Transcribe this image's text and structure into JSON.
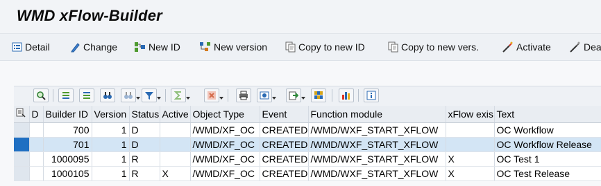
{
  "title": "WMD xFlow-Builder",
  "toolbar": [
    {
      "label": "Detail",
      "icon": "detail-icon"
    },
    {
      "label": "Change",
      "icon": "pencil-icon"
    },
    {
      "label": "New ID",
      "icon": "new-id-icon"
    },
    {
      "label": "New version",
      "icon": "new-version-icon"
    },
    {
      "label": "Copy to new ID",
      "icon": "copy-icon"
    },
    {
      "label": "Copy to new vers.",
      "icon": "copy-icon"
    },
    {
      "label": "Activate",
      "icon": "wand-icon"
    },
    {
      "label": "Dea",
      "icon": "wand-icon"
    }
  ],
  "grid": {
    "headers": [
      "",
      "D",
      "Builder ID",
      "Version",
      "Status",
      "Active",
      "Object Type",
      "Event",
      "Function module",
      "xFlow exis",
      "Text"
    ],
    "rows": [
      {
        "d": "",
        "builder_id": "700",
        "version": "1",
        "status": "D",
        "active": "",
        "object_type": "/WMD/XF_OC",
        "event": "CREATED",
        "function_module": "/WMD/WXF_START_XFLOW",
        "xflow_exists": "",
        "text": "OC Workflow"
      },
      {
        "d": "",
        "builder_id": "701",
        "version": "1",
        "status": "D",
        "active": "",
        "object_type": "/WMD/XF_OC",
        "event": "CREATED",
        "function_module": "/WMD/WXF_START_XFLOW",
        "xflow_exists": "",
        "text": "OC Workflow Release"
      },
      {
        "d": "",
        "builder_id": "1000095",
        "version": "1",
        "status": "R",
        "active": "",
        "object_type": "/WMD/XF_OC",
        "event": "CREATED",
        "function_module": "/WMD/WXF_START_XFLOW",
        "xflow_exists": "X",
        "text": "OC Test 1"
      },
      {
        "d": "",
        "builder_id": "1000105",
        "version": "1",
        "status": "R",
        "active": "X",
        "object_type": "/WMD/XF_OC",
        "event": "CREATED",
        "function_module": "/WMD/WXF_START_XFLOW",
        "xflow_exists": "X",
        "text": "OC Test Release"
      }
    ]
  },
  "colors": {
    "selected_row": "#d3e5f5",
    "selected_marker": "#1f6fc2"
  }
}
